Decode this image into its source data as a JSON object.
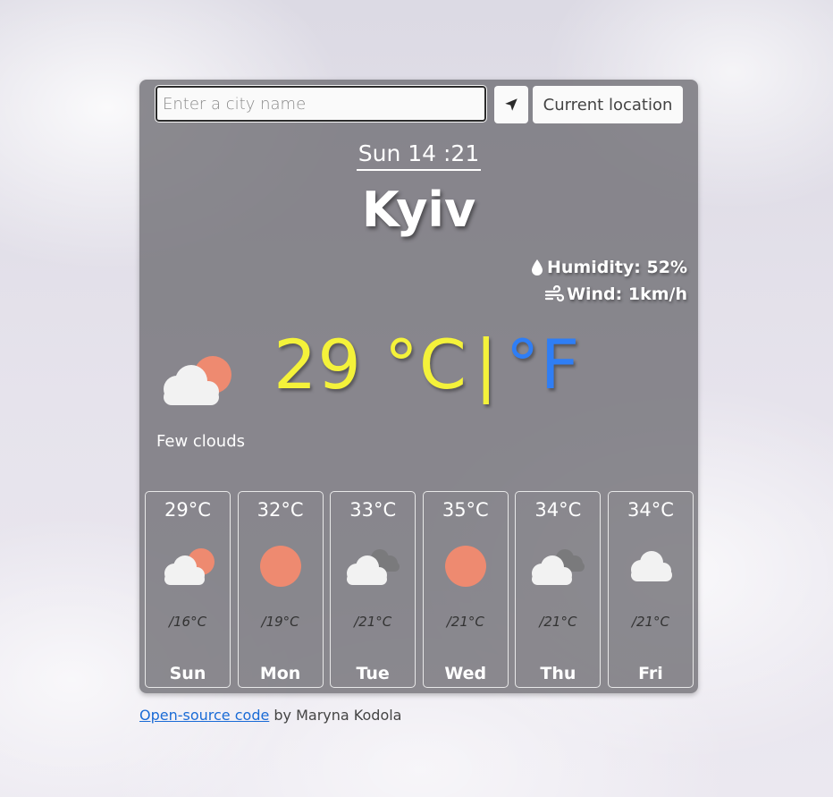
{
  "search": {
    "placeholder": "Enter a city name"
  },
  "buttons": {
    "current_location": "Current location"
  },
  "header": {
    "date": "Sun 14 :21",
    "city": "Kyiv"
  },
  "stats": {
    "humidity": "Humidity: 52%",
    "wind": "Wind: 1km/h"
  },
  "current": {
    "temp": "29",
    "unit_c": "°C",
    "separator": "|",
    "unit_f": "°F",
    "description": "Few clouds",
    "icon": "few-clouds-icon"
  },
  "forecast": [
    {
      "max": "29°C",
      "min": "/16°C",
      "day": "Sun",
      "icon": "few-clouds-icon"
    },
    {
      "max": "32°C",
      "min": "/19°C",
      "day": "Mon",
      "icon": "sun-icon"
    },
    {
      "max": "33°C",
      "min": "/21°C",
      "day": "Tue",
      "icon": "broken-clouds-icon"
    },
    {
      "max": "35°C",
      "min": "/21°C",
      "day": "Wed",
      "icon": "sun-icon"
    },
    {
      "max": "34°C",
      "min": "/21°C",
      "day": "Thu",
      "icon": "broken-clouds-icon"
    },
    {
      "max": "34°C",
      "min": "/21°C",
      "day": "Fri",
      "icon": "cloud-icon"
    }
  ],
  "footer": {
    "link": "Open-source code",
    "credit": " by Maryna Kodola"
  },
  "colors": {
    "celsius": "#f4f23a",
    "fahrenheit": "#2f7ef5",
    "sun": "#ee8a70",
    "card": "#737278"
  }
}
